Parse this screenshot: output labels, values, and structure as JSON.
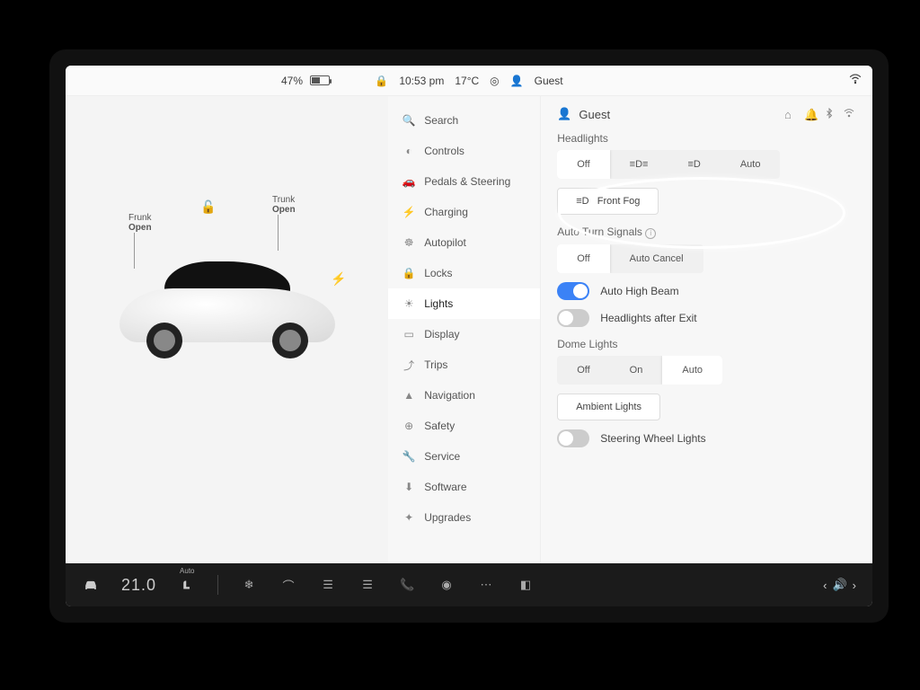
{
  "topbar": {
    "battery_pct": "47%",
    "clock": "10:53 pm",
    "temp": "17°C",
    "profile": "Guest"
  },
  "car": {
    "frunk_label": "Frunk",
    "frunk_state": "Open",
    "trunk_label": "Trunk",
    "trunk_state": "Open"
  },
  "sidebar": {
    "items": [
      {
        "icon": "search",
        "label": "Search"
      },
      {
        "icon": "controls",
        "label": "Controls"
      },
      {
        "icon": "pedals",
        "label": "Pedals & Steering"
      },
      {
        "icon": "charging",
        "label": "Charging"
      },
      {
        "icon": "autopilot",
        "label": "Autopilot"
      },
      {
        "icon": "locks",
        "label": "Locks"
      },
      {
        "icon": "lights",
        "label": "Lights"
      },
      {
        "icon": "display",
        "label": "Display"
      },
      {
        "icon": "trips",
        "label": "Trips"
      },
      {
        "icon": "navigation",
        "label": "Navigation"
      },
      {
        "icon": "safety",
        "label": "Safety"
      },
      {
        "icon": "service",
        "label": "Service"
      },
      {
        "icon": "software",
        "label": "Software"
      },
      {
        "icon": "upgrades",
        "label": "Upgrades"
      }
    ],
    "active_index": 6
  },
  "main": {
    "profile": "Guest",
    "headlights": {
      "label": "Headlights",
      "options": [
        "Off",
        "≡D≡",
        "≡D",
        "Auto"
      ],
      "selected": 0
    },
    "front_fog": {
      "label": "Front Fog"
    },
    "auto_signals": {
      "label": "Auto Turn Signals",
      "options": [
        "Off",
        "Auto Cancel"
      ],
      "selected": 0
    },
    "auto_high_beam": {
      "label": "Auto High Beam",
      "on": true
    },
    "headlights_after_exit": {
      "label": "Headlights after Exit",
      "on": false
    },
    "dome": {
      "label": "Dome Lights",
      "options": [
        "Off",
        "On",
        "Auto"
      ],
      "selected": 2
    },
    "ambient": {
      "label": "Ambient Lights"
    },
    "steering_wheel_lights": {
      "label": "Steering Wheel Lights",
      "on": false
    }
  },
  "dock": {
    "temp": "21.0",
    "seat_auto": "Auto"
  }
}
